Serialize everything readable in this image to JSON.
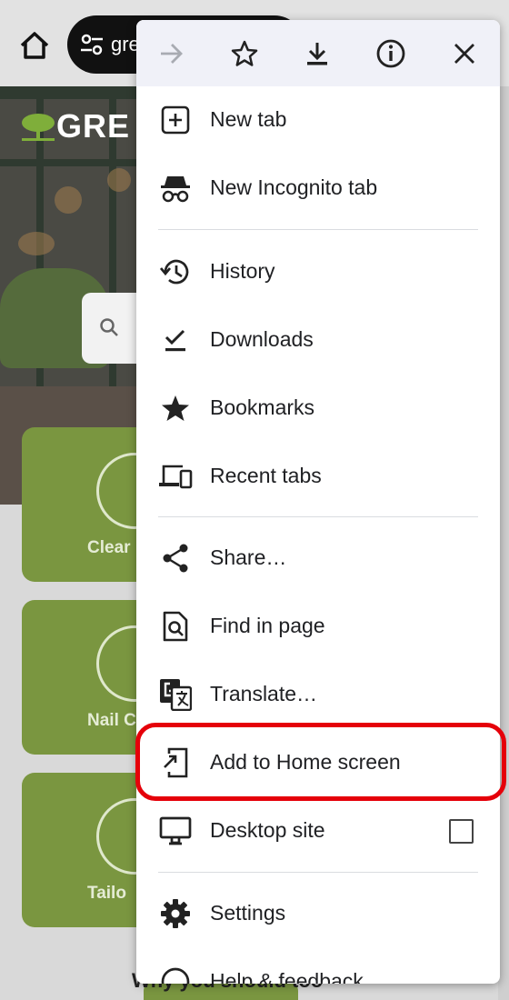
{
  "browser": {
    "url_text": "gre"
  },
  "background_page": {
    "logo_text": "GRE",
    "cards": [
      {
        "label": "Clear"
      },
      {
        "label": "Nail C"
      },
      {
        "label": "Tailo"
      }
    ],
    "bottom_heading": "Why you should too"
  },
  "menu": {
    "toolbar": {
      "forward": "arrow-forward-icon",
      "bookmark": "star-outline-icon",
      "download": "download-icon",
      "info": "info-icon",
      "close": "close-icon"
    },
    "items": [
      {
        "label": "New tab",
        "icon": "new-tab-icon"
      },
      {
        "label": "New Incognito tab",
        "icon": "incognito-icon"
      },
      {
        "label": "History",
        "icon": "history-icon"
      },
      {
        "label": "Downloads",
        "icon": "downloads-check-icon"
      },
      {
        "label": "Bookmarks",
        "icon": "star-icon"
      },
      {
        "label": "Recent tabs",
        "icon": "devices-icon"
      },
      {
        "label": "Share…",
        "icon": "share-icon"
      },
      {
        "label": "Find in page",
        "icon": "find-in-page-icon"
      },
      {
        "label": "Translate…",
        "icon": "translate-icon"
      },
      {
        "label": "Add to Home screen",
        "icon": "add-to-home-icon"
      },
      {
        "label": "Desktop site",
        "icon": "monitor-icon",
        "checked": false
      },
      {
        "label": "Settings",
        "icon": "gear-icon"
      },
      {
        "label": "Help & feedback",
        "icon": "help-icon"
      }
    ],
    "highlight_color": "#e5000a"
  }
}
